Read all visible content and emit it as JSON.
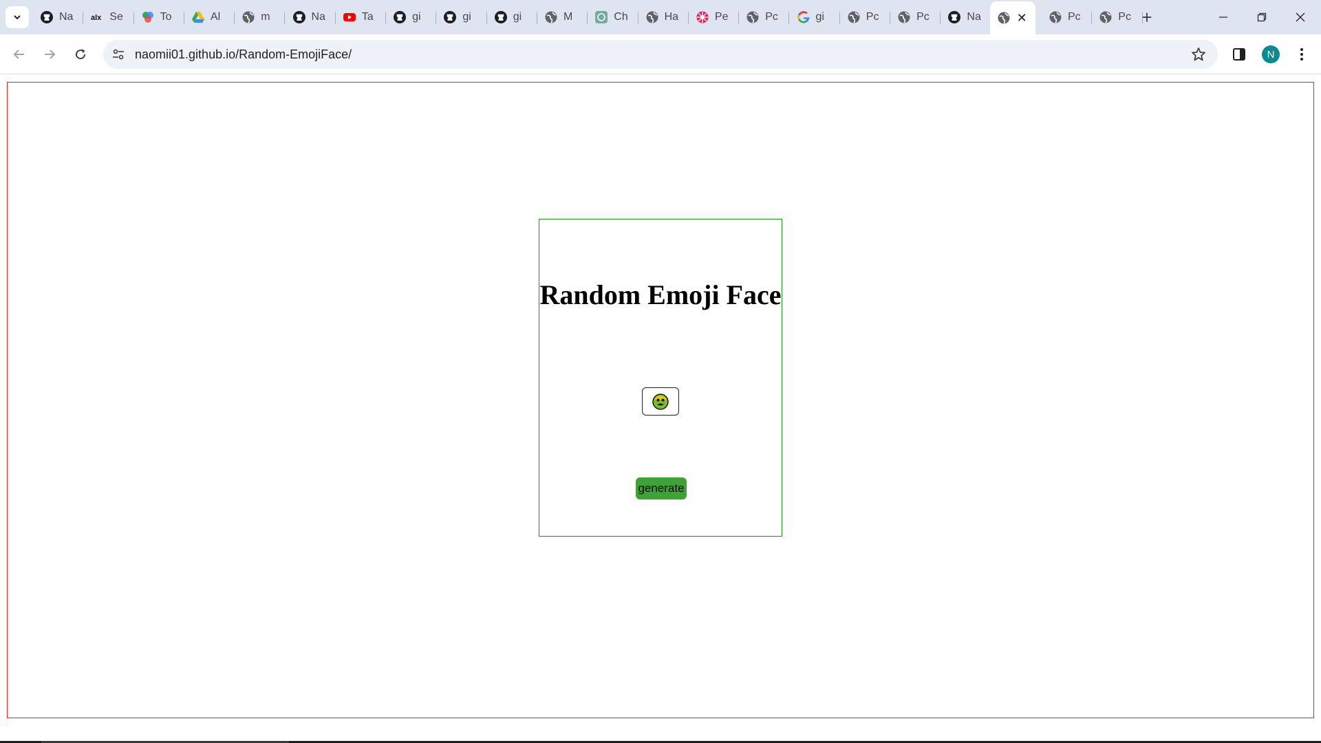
{
  "browser": {
    "tabs": [
      {
        "title": "Na",
        "icon": "github-icon"
      },
      {
        "title": "Se",
        "icon": "alx-icon"
      },
      {
        "title": "To",
        "icon": "app-icon"
      },
      {
        "title": "Al",
        "icon": "drive-icon"
      },
      {
        "title": "m",
        "icon": "globe-icon"
      },
      {
        "title": "Na",
        "icon": "github-icon"
      },
      {
        "title": "Ta",
        "icon": "youtube-icon"
      },
      {
        "title": "gi",
        "icon": "github-icon"
      },
      {
        "title": "gi",
        "icon": "github-icon"
      },
      {
        "title": "gi",
        "icon": "github-icon"
      },
      {
        "title": "M",
        "icon": "globe-icon"
      },
      {
        "title": "Ch",
        "icon": "chatgpt-icon"
      },
      {
        "title": "Ha",
        "icon": "globe-icon"
      },
      {
        "title": "Pe",
        "icon": "flower-icon"
      },
      {
        "title": "Pc",
        "icon": "globe-icon"
      },
      {
        "title": "gi",
        "icon": "google-icon"
      },
      {
        "title": "Pc",
        "icon": "globe-icon"
      },
      {
        "title": "Pc",
        "icon": "globe-icon"
      },
      {
        "title": "Na",
        "icon": "github-icon"
      },
      {
        "title": "",
        "icon": "globe-icon",
        "active": true
      },
      {
        "title": "Pc",
        "icon": "globe-icon"
      },
      {
        "title": "Pc",
        "icon": "globe-icon"
      }
    ],
    "url": "naomii01.github.io/Random-EmojiFace/",
    "profile_initial": "N"
  },
  "page": {
    "title": "Random Emoji Face",
    "emoji": "🤢",
    "button_label": "generate"
  },
  "colors": {
    "frame_border": "#d9252b",
    "card_border": "#1e8a1e",
    "button_bg": "#3ca334"
  }
}
